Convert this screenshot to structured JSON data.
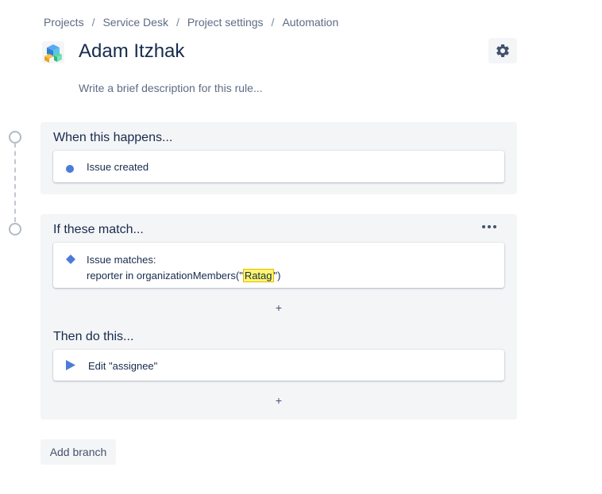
{
  "breadcrumb": {
    "items": [
      "Projects",
      "Service Desk",
      "Project settings",
      "Automation"
    ],
    "separator": "/"
  },
  "rule": {
    "title": "Adam Itzhak",
    "description_placeholder": "Write a brief description for this rule..."
  },
  "trigger_section": {
    "title": "When this happens...",
    "card": {
      "label": "Issue created",
      "icon": "circle-dot-icon"
    }
  },
  "condition_section": {
    "title": "If these match...",
    "card": {
      "line1": "Issue matches:",
      "line2_prefix": "reporter in organizationMembers(\"",
      "line2_highlight": "Ratag",
      "line2_suffix": "\")",
      "icon": "diamond-icon"
    },
    "add": "+"
  },
  "action_section": {
    "title": "Then do this...",
    "card": {
      "label": "Edit \"assignee\"",
      "icon": "play-icon"
    },
    "add": "+"
  },
  "add_branch_label": "Add branch",
  "colors": {
    "accent": "#4c7bd9",
    "section_bg": "#f4f5f7",
    "highlight": "#fff66b"
  }
}
